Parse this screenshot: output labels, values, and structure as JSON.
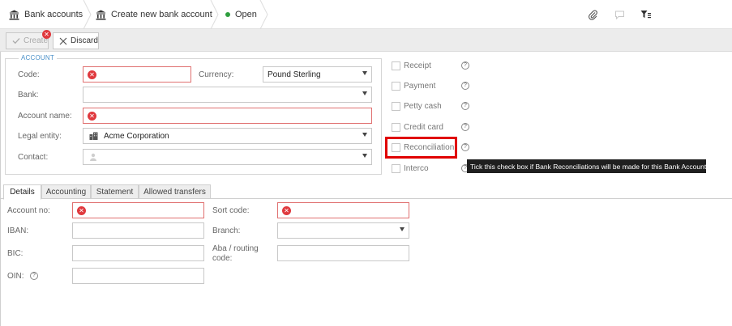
{
  "breadcrumb": {
    "items": [
      {
        "label": "Bank accounts",
        "icon": "bank-icon"
      },
      {
        "label": "Create new bank account",
        "icon": "bank-icon"
      },
      {
        "label": "Open",
        "icon": "status-dot",
        "color": "#2e9e3e"
      }
    ]
  },
  "toolbar_icons": [
    "paperclip-icon",
    "comment-icon",
    "filter-icon"
  ],
  "actions": {
    "create_label": "Create",
    "discard_label": "Discard"
  },
  "account_group": {
    "title": "ACCOUNT",
    "code_label": "Code:",
    "code_value": "",
    "currency_label": "Currency:",
    "currency_value": "Pound Sterling",
    "bank_label": "Bank:",
    "bank_value": "",
    "account_name_label": "Account name:",
    "account_name_value": "",
    "legal_entity_label": "Legal entity:",
    "legal_entity_value": "Acme Corporation",
    "contact_label": "Contact:",
    "contact_value": ""
  },
  "checkboxes": [
    {
      "label": "Receipt",
      "checked": false
    },
    {
      "label": "Payment",
      "checked": false
    },
    {
      "label": "Petty cash",
      "checked": false
    },
    {
      "label": "Credit card",
      "checked": false
    },
    {
      "label": "Reconciliation",
      "checked": false
    },
    {
      "label": "Interco",
      "checked": false
    }
  ],
  "tooltip": "Tick this check box if Bank Reconciliations will be made for this Bank Account",
  "tabs": [
    {
      "label": "Details",
      "active": true
    },
    {
      "label": "Accounting",
      "active": false
    },
    {
      "label": "Statement",
      "active": false
    },
    {
      "label": "Allowed transfers",
      "active": false
    }
  ],
  "details": {
    "account_no_label": "Account no:",
    "account_no_value": "",
    "sort_code_label": "Sort code:",
    "sort_code_value": "",
    "iban_label": "IBAN:",
    "iban_value": "",
    "branch_label": "Branch:",
    "branch_value": "",
    "bic_label": "BIC:",
    "bic_value": "",
    "aba_label_line1": "Aba / routing",
    "aba_label_line2": "code:",
    "aba_value": "",
    "oin_label": "OIN:",
    "oin_value": ""
  },
  "colors": {
    "error": "#e0393e",
    "highlight": "#e00000",
    "accent": "#4a90c8",
    "status_open": "#2e9e3e"
  }
}
